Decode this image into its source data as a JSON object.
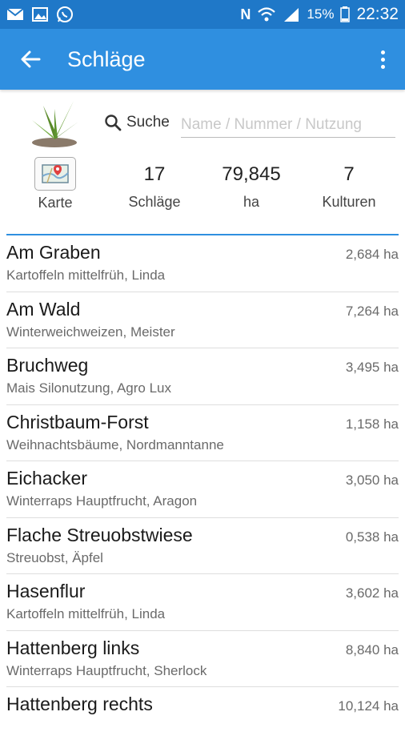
{
  "status_bar": {
    "battery": "15%",
    "time": "22:32",
    "network_letter": "N"
  },
  "app_bar": {
    "title": "Schläge"
  },
  "search": {
    "label": "Suche",
    "placeholder": "Name / Nummer / Nutzung",
    "value": ""
  },
  "stats": {
    "map_label": "Karte",
    "fields_count": "17",
    "fields_label": "Schläge",
    "area_value": "79,845",
    "area_label": "ha",
    "crops_count": "7",
    "crops_label": "Kulturen"
  },
  "fields": [
    {
      "name": "Am Graben",
      "crop": "Kartoffeln mittelfrüh, Linda",
      "area": "2,684 ha"
    },
    {
      "name": "Am Wald",
      "crop": "Winterweichweizen, Meister",
      "area": "7,264 ha"
    },
    {
      "name": "Bruchweg",
      "crop": "Mais Silonutzung, Agro Lux",
      "area": "3,495 ha"
    },
    {
      "name": "Christbaum-Forst",
      "crop": "Weihnachtsbäume, Nordmanntanne",
      "area": "1,158 ha"
    },
    {
      "name": "Eichacker",
      "crop": "Winterraps Hauptfrucht, Aragon",
      "area": "3,050 ha"
    },
    {
      "name": "Flache Streuobstwiese",
      "crop": "Streuobst, Äpfel",
      "area": "0,538 ha"
    },
    {
      "name": "Hasenflur",
      "crop": "Kartoffeln mittelfrüh, Linda",
      "area": "3,602 ha"
    },
    {
      "name": "Hattenberg links",
      "crop": "Winterraps Hauptfrucht, Sherlock",
      "area": "8,840 ha"
    },
    {
      "name": "Hattenberg rechts",
      "crop": "",
      "area": "10,124 ha"
    }
  ],
  "colors": {
    "status_bar": "#1f78c8",
    "app_bar": "#2f8fe0",
    "accent_divider": "#2f8fe0"
  }
}
